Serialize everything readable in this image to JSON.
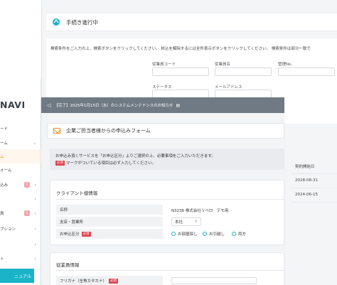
{
  "back_window": {
    "title": "手続き進行中",
    "description": "検索条件をご入力の上、検索ボタンをクリックしてください。 絞込を解除するには全件表示ボタンをクリックしてください。 検索条件は部分一致で",
    "fields": {
      "employee_code": "従業員コード",
      "employee_name": "従業員名",
      "manage_no": "管理No.",
      "status": "ステータス",
      "email": "メールアドレス"
    },
    "table": {
      "contract_start_header": "契約開始日",
      "rows": [
        "2028-08-31",
        "2024-06-15"
      ]
    }
  },
  "sidebar": {
    "logo": "NAVI",
    "items": [
      {
        "label": "ード",
        "chevron": false
      },
      {
        "label": "ーム",
        "chevron": true
      },
      {
        "label": "ム",
        "chevron": false
      },
      {
        "label": "ォーム",
        "chevron": false
      },
      {
        "label": "込み",
        "chevron": true,
        "badge": "1"
      },
      {
        "label": "",
        "chevron": true
      },
      {
        "label": "員",
        "chevron": true,
        "badge": "1"
      },
      {
        "label": "プション",
        "chevron": true
      },
      {
        "label": "",
        "chevron": true
      },
      {
        "label": "ト",
        "chevron": true
      }
    ],
    "manual_button": "ニュアル"
  },
  "front_window": {
    "notice": "【完了】2025年1月15日（水）のシステムメンテナンスのお知らせ",
    "form_title": "企業ご担当者様からの申込みフォーム",
    "info_line1": "お申込み頂くサービスを「お申込区分」よりご選択の上、必要事項をご入力いただきます。",
    "info_required_tag": "必須",
    "info_line2": "マークがついている項目は必ず入力してください。",
    "client_section": {
      "title": "クライアント様情報",
      "name_label": "名称",
      "name_value": "N3236 株式会社リベロ　デモ用",
      "branch_label": "支店・営業所",
      "branch_value": "本社",
      "category_label": "お申込区分",
      "required_tag": "必須",
      "radio_options": [
        "お部屋探し",
        "お引越し",
        "両方"
      ]
    },
    "employee_section": {
      "title": "従業員情報",
      "furigana_label": "フリガナ（全角カタカナ）",
      "required_tag": "必須"
    }
  },
  "colors": {
    "accent_orange": "#ef8a1c",
    "teal": "#1ab3c7",
    "notice_bar": "#6f7a84",
    "required_red": "#e0424f"
  }
}
